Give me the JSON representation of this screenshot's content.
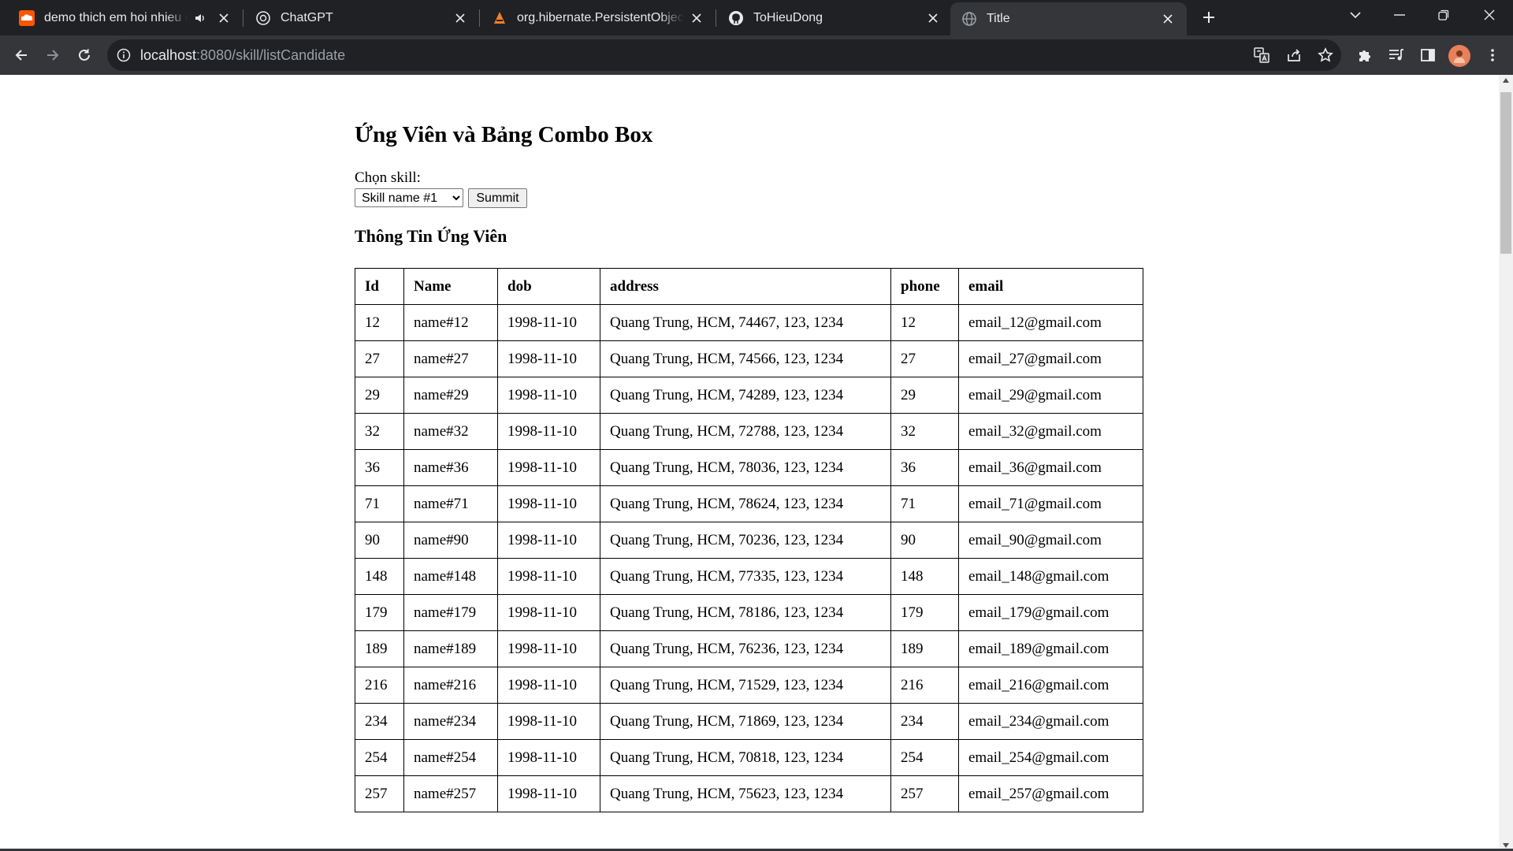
{
  "browser": {
    "tabs": [
      {
        "title": "demo thich em hoi nhieu mà",
        "icon": "soundcloud-icon",
        "audio": true,
        "active": false
      },
      {
        "title": "ChatGPT",
        "icon": "chatgpt-icon",
        "active": false
      },
      {
        "title": "org.hibernate.PersistentObjectEx",
        "icon": "hibernate-icon",
        "active": false
      },
      {
        "title": "ToHieuDong",
        "icon": "github-icon",
        "active": false
      },
      {
        "title": "Title",
        "icon": "globe-icon",
        "active": true
      }
    ],
    "url_host": "localhost",
    "url_rest": ":8080/skill/listCandidate",
    "colors": {
      "tabstrip": "#202124",
      "toolbar": "#35363a",
      "avatar": "#e8805a"
    }
  },
  "page": {
    "title": "Ứng Viên và Bảng Combo Box",
    "skill_label": "Chọn skill:",
    "skill_selected": "Skill name #1",
    "submit_label": "Summit",
    "section_title": "Thông Tin Ứng Viên",
    "table": {
      "headers": [
        "Id",
        "Name",
        "dob",
        "address",
        "phone",
        "email"
      ],
      "rows": [
        [
          "12",
          "name#12",
          "1998-11-10",
          "Quang Trung, HCM, 74467, 123, 1234",
          "12",
          "email_12@gmail.com"
        ],
        [
          "27",
          "name#27",
          "1998-11-10",
          "Quang Trung, HCM, 74566, 123, 1234",
          "27",
          "email_27@gmail.com"
        ],
        [
          "29",
          "name#29",
          "1998-11-10",
          "Quang Trung, HCM, 74289, 123, 1234",
          "29",
          "email_29@gmail.com"
        ],
        [
          "32",
          "name#32",
          "1998-11-10",
          "Quang Trung, HCM, 72788, 123, 1234",
          "32",
          "email_32@gmail.com"
        ],
        [
          "36",
          "name#36",
          "1998-11-10",
          "Quang Trung, HCM, 78036, 123, 1234",
          "36",
          "email_36@gmail.com"
        ],
        [
          "71",
          "name#71",
          "1998-11-10",
          "Quang Trung, HCM, 78624, 123, 1234",
          "71",
          "email_71@gmail.com"
        ],
        [
          "90",
          "name#90",
          "1998-11-10",
          "Quang Trung, HCM, 70236, 123, 1234",
          "90",
          "email_90@gmail.com"
        ],
        [
          "148",
          "name#148",
          "1998-11-10",
          "Quang Trung, HCM, 77335, 123, 1234",
          "148",
          "email_148@gmail.com"
        ],
        [
          "179",
          "name#179",
          "1998-11-10",
          "Quang Trung, HCM, 78186, 123, 1234",
          "179",
          "email_179@gmail.com"
        ],
        [
          "189",
          "name#189",
          "1998-11-10",
          "Quang Trung, HCM, 76236, 123, 1234",
          "189",
          "email_189@gmail.com"
        ],
        [
          "216",
          "name#216",
          "1998-11-10",
          "Quang Trung, HCM, 71529, 123, 1234",
          "216",
          "email_216@gmail.com"
        ],
        [
          "234",
          "name#234",
          "1998-11-10",
          "Quang Trung, HCM, 71869, 123, 1234",
          "234",
          "email_234@gmail.com"
        ],
        [
          "254",
          "name#254",
          "1998-11-10",
          "Quang Trung, HCM, 70818, 123, 1234",
          "254",
          "email_254@gmail.com"
        ],
        [
          "257",
          "name#257",
          "1998-11-10",
          "Quang Trung, HCM, 75623, 123, 1234",
          "257",
          "email_257@gmail.com"
        ]
      ]
    }
  }
}
